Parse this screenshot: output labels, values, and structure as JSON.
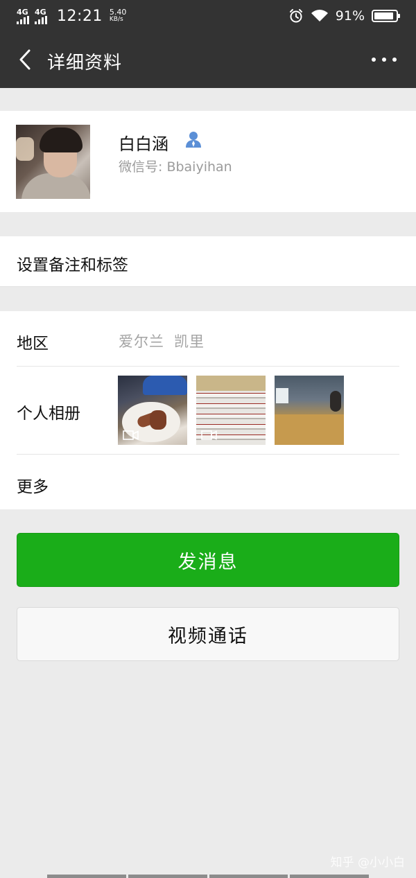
{
  "status_bar": {
    "network_1": "4G",
    "network_2": "4G",
    "time": "12:21",
    "speed_value": "5.40",
    "speed_unit": "KB/s",
    "battery_percent": "91%",
    "battery_level": 0.91,
    "icons": [
      "alarm-icon",
      "wifi-icon",
      "battery-icon"
    ]
  },
  "header": {
    "title": "详细资料",
    "back_icon": "chevron-left-icon",
    "more_icon": "more-dots-icon"
  },
  "profile": {
    "name": "白白涵",
    "wechat_id": "微信号: Bbaiyihan",
    "contact_icon": "person-icon",
    "icon_color": "#5b8fd6"
  },
  "remark": {
    "label": "设置备注和标签"
  },
  "info": {
    "region_label": "地区",
    "region_country": "爱尔兰",
    "region_city": "凯里",
    "album_label": "个人相册",
    "more_label": "更多"
  },
  "actions": {
    "send_message": "发消息",
    "video_call": "视频通话",
    "primary_color": "#1aad19"
  },
  "watermark": "知乎 @小小白"
}
